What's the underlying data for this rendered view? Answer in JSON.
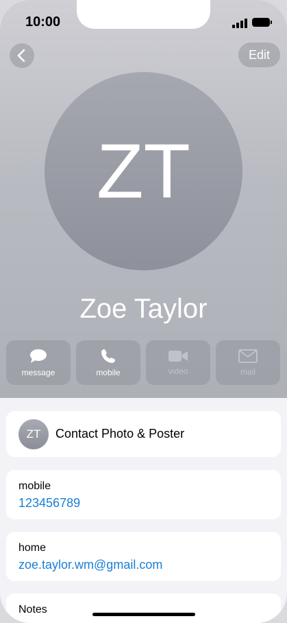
{
  "status_bar": {
    "time": "10:00"
  },
  "nav": {
    "edit_label": "Edit"
  },
  "contact": {
    "initials": "ZT",
    "name": "Zoe Taylor"
  },
  "actions": [
    {
      "label": "message",
      "icon": "message-icon",
      "enabled": true
    },
    {
      "label": "mobile",
      "icon": "phone-icon",
      "enabled": true
    },
    {
      "label": "video",
      "icon": "video-icon",
      "enabled": false
    },
    {
      "label": "mail",
      "icon": "mail-icon",
      "enabled": false
    }
  ],
  "poster": {
    "initials": "ZT",
    "label": "Contact Photo & Poster"
  },
  "fields": {
    "mobile": {
      "label": "mobile",
      "value": "123456789"
    },
    "home": {
      "label": "home",
      "value": "zoe.taylor.wm@gmail.com"
    }
  },
  "notes": {
    "label": "Notes"
  },
  "colors": {
    "link": "#1a7fd6",
    "background": "#f2f2f7"
  }
}
